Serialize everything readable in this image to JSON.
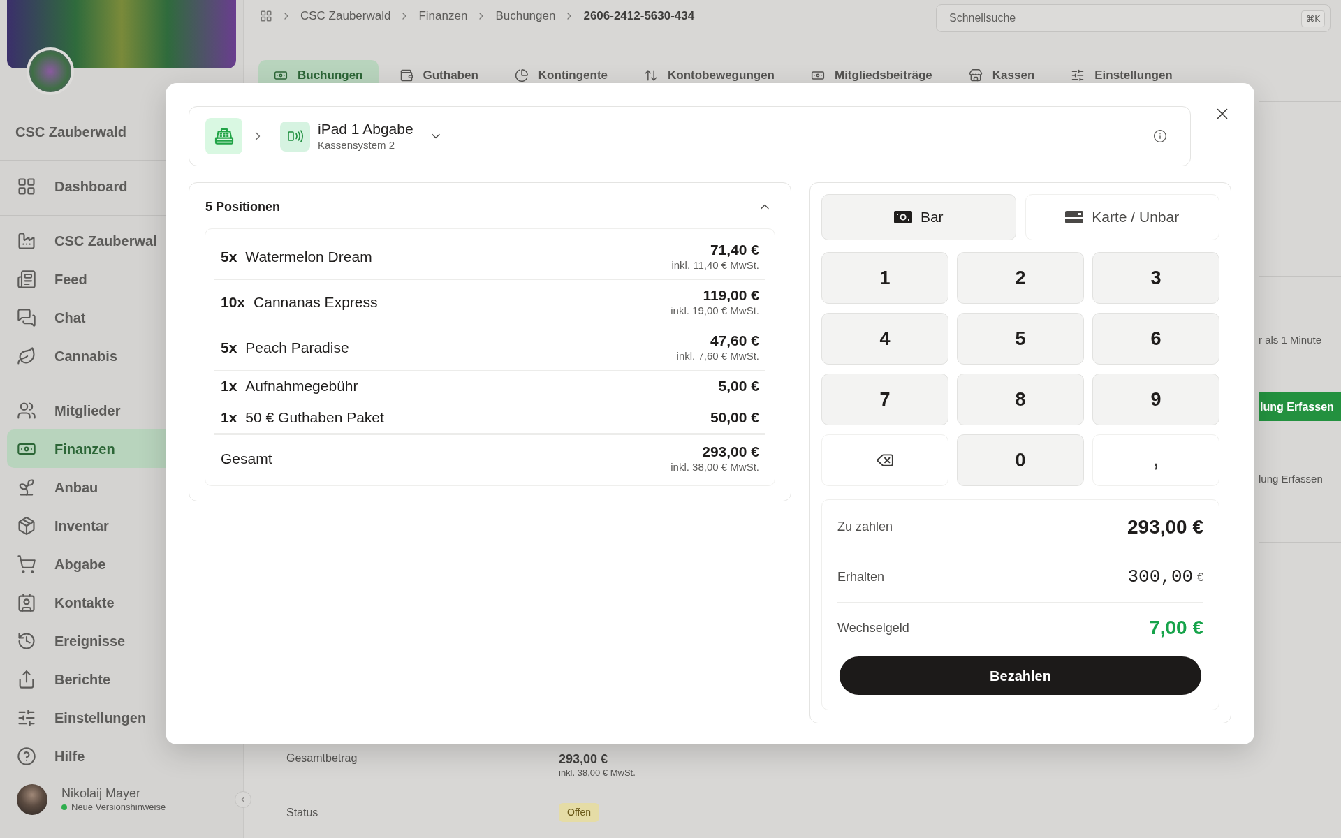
{
  "sidebar": {
    "org_name": "CSC Zauberwald",
    "nav_groups": [
      {
        "items": [
          {
            "label": "Dashboard",
            "selected": false
          }
        ]
      },
      {
        "items": [
          {
            "label": "CSC Zauberwal",
            "selected": false
          },
          {
            "label": "Feed",
            "selected": false
          },
          {
            "label": "Chat",
            "selected": false
          },
          {
            "label": "Cannabis",
            "selected": false
          }
        ]
      },
      {
        "items": [
          {
            "label": "Mitglieder",
            "selected": false
          },
          {
            "label": "Finanzen",
            "selected": true
          },
          {
            "label": "Anbau",
            "selected": false
          },
          {
            "label": "Inventar",
            "selected": false
          },
          {
            "label": "Abgabe",
            "selected": false
          },
          {
            "label": "Kontakte",
            "selected": false
          },
          {
            "label": "Ereignisse",
            "selected": false
          },
          {
            "label": "Berichte",
            "selected": false
          },
          {
            "label": "Einstellungen",
            "selected": false
          },
          {
            "label": "Hilfe",
            "selected": false
          }
        ]
      }
    ],
    "user": {
      "name": "Nikolaij Mayer",
      "status": "Neue Versionshinweise"
    }
  },
  "topbar": {
    "breadcrumbs": [
      "CSC Zauberwald",
      "Finanzen",
      "Buchungen",
      "2606-2412-5630-434"
    ],
    "search": {
      "placeholder": "Schnellsuche",
      "shortcut": "⌘K"
    }
  },
  "tabs": [
    {
      "label": "Buchungen",
      "selected": true
    },
    {
      "label": "Guthaben",
      "selected": false
    },
    {
      "label": "Kontingente",
      "selected": false
    },
    {
      "label": "Kontobewegungen",
      "selected": false
    },
    {
      "label": "Mitgliedsbeiträge",
      "selected": false
    },
    {
      "label": "Kassen",
      "selected": false
    },
    {
      "label": "Einstellungen",
      "selected": false
    }
  ],
  "page_fragments": {
    "time_note": "r als 1 Minute",
    "action_button": "lung Erfassen",
    "action_link": "lung Erfassen"
  },
  "booking_details": [
    {
      "kind": "amount",
      "label": "Gesamtbetrag",
      "value": "293,00 €",
      "note": "inkl. 38,00 € MwSt."
    },
    {
      "kind": "status",
      "label": "Status",
      "value": "Offen"
    }
  ],
  "dialog": {
    "register": {
      "name": "iPad 1 Abgabe",
      "system": "Kassensystem 2"
    },
    "positions": {
      "title": "5 Positionen",
      "expanded": true,
      "items": [
        {
          "qty": "5x",
          "name": "Watermelon Dream",
          "price": "71,40 €",
          "tax": "inkl. 11,40 € MwSt."
        },
        {
          "qty": "10x",
          "name": "Cannanas Express",
          "price": "119,00 €",
          "tax": "inkl. 19,00 € MwSt."
        },
        {
          "qty": "5x",
          "name": "Peach Paradise",
          "price": "47,60 €",
          "tax": "inkl. 7,60 € MwSt."
        },
        {
          "qty": "1x",
          "name": "Aufnahmegebühr",
          "price": "5,00 €"
        },
        {
          "qty": "1x",
          "name": "50 € Guthaben Paket",
          "price": "50,00 €"
        }
      ],
      "total": {
        "label": "Gesamt",
        "price": "293,00 €",
        "tax": "inkl. 38,00 € MwSt."
      }
    },
    "payment_methods": [
      {
        "label": "Bar",
        "selected": true
      },
      {
        "label": "Karte / Unbar",
        "selected": false
      }
    ],
    "keypad": [
      {
        "kind": "digit",
        "label": "1"
      },
      {
        "kind": "digit",
        "label": "2"
      },
      {
        "kind": "digit",
        "label": "3"
      },
      {
        "kind": "digit",
        "label": "4"
      },
      {
        "kind": "digit",
        "label": "5"
      },
      {
        "kind": "digit",
        "label": "6"
      },
      {
        "kind": "digit",
        "label": "7"
      },
      {
        "kind": "digit",
        "label": "8"
      },
      {
        "kind": "digit",
        "label": "9"
      },
      {
        "kind": "backspace"
      },
      {
        "kind": "digit",
        "label": "0"
      },
      {
        "kind": "symbol",
        "label": ","
      }
    ],
    "summary": [
      {
        "kind": "due",
        "label": "Zu zahlen",
        "value": "293,00 €"
      },
      {
        "kind": "received",
        "label": "Erhalten",
        "value": "300,00",
        "suffix": "€"
      },
      {
        "kind": "change",
        "label": "Wechselgeld",
        "value": "7,00 €"
      }
    ],
    "pay_button": "Bezahlen"
  }
}
